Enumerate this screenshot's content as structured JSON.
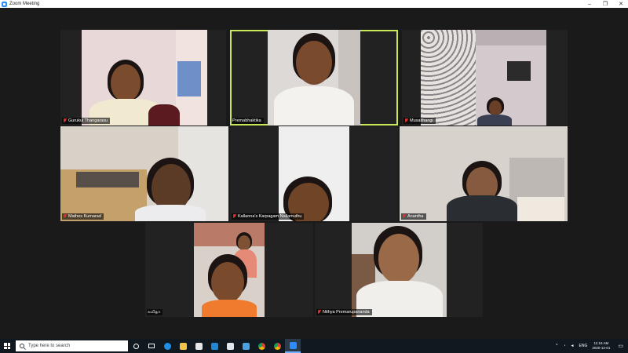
{
  "window": {
    "title": "Zoom Meeting"
  },
  "participants": [
    {
      "name": "Gurukul Thangarasu"
    },
    {
      "name": "Premabhaktika"
    },
    {
      "name": "Musalthangi"
    },
    {
      "name": "Mathes Kumarad"
    },
    {
      "name": "Kallanna's Karpagam Nallamuthu"
    },
    {
      "name": "Anantha"
    },
    {
      "name": "கவிதா"
    },
    {
      "name": "Nithya Premarupananda"
    }
  ],
  "taskbar": {
    "search_placeholder": "Type here to search",
    "tray_language": "ENG",
    "time": "11:16 AM",
    "date": "2020-12-01"
  },
  "colors": {
    "active_speaker_border": "#c8e85a",
    "muted_mic": "#e0322b",
    "zoom_blue": "#2d8cff"
  }
}
